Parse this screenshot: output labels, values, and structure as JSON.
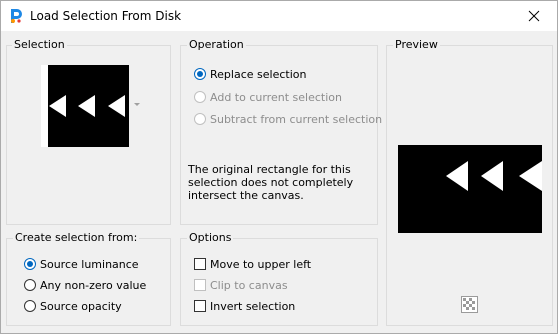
{
  "window": {
    "title": "Load Selection From Disk"
  },
  "selection": {
    "label": "Selection"
  },
  "operation": {
    "label": "Operation",
    "options": [
      {
        "label": "Replace selection",
        "checked": true,
        "enabled": true
      },
      {
        "label": "Add to current selection",
        "checked": false,
        "enabled": false
      },
      {
        "label": "Subtract from current selection",
        "checked": false,
        "enabled": false
      }
    ],
    "info_text": "The original rectangle for this selection does not completely intersect the canvas."
  },
  "preview": {
    "label": "Preview"
  },
  "create_from": {
    "label": "Create selection from:",
    "options": [
      {
        "label": "Source luminance",
        "checked": true
      },
      {
        "label": "Any non-zero value",
        "checked": false
      },
      {
        "label": "Source opacity",
        "checked": false
      }
    ]
  },
  "options": {
    "label": "Options",
    "items": [
      {
        "label": "Move to upper left",
        "checked": false,
        "enabled": true
      },
      {
        "label": "Clip to canvas",
        "checked": false,
        "enabled": false
      },
      {
        "label": "Invert selection",
        "checked": false,
        "enabled": true
      }
    ]
  },
  "colors": {
    "accent": "#0067c0",
    "disabled_text": "#8d8d8d",
    "group_border": "#dcdcdc",
    "background": "#f0f0f0"
  }
}
